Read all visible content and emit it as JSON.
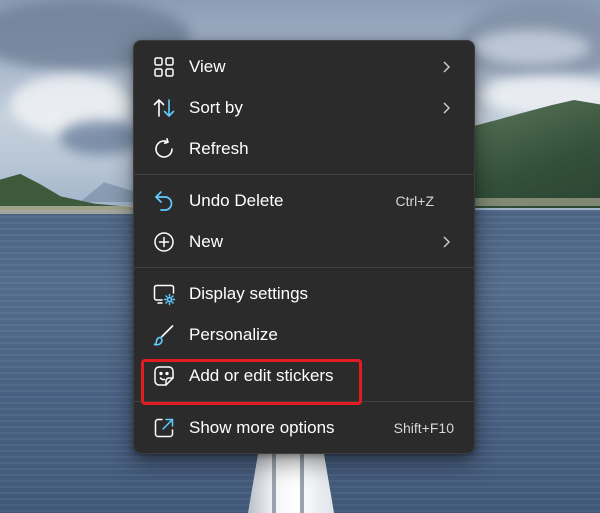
{
  "menu": {
    "items": [
      {
        "label": "View",
        "icon": "grid-view-icon",
        "has_submenu": true,
        "shortcut": ""
      },
      {
        "label": "Sort by",
        "icon": "sort-arrows-icon",
        "has_submenu": true,
        "shortcut": ""
      },
      {
        "label": "Refresh",
        "icon": "refresh-icon",
        "has_submenu": false,
        "shortcut": ""
      },
      {
        "label": "Undo Delete",
        "icon": "undo-icon",
        "has_submenu": false,
        "shortcut": "Ctrl+Z"
      },
      {
        "label": "New",
        "icon": "plus-circle-icon",
        "has_submenu": true,
        "shortcut": ""
      },
      {
        "label": "Display settings",
        "icon": "display-settings-icon",
        "has_submenu": false,
        "shortcut": ""
      },
      {
        "label": "Personalize",
        "icon": "brush-icon",
        "has_submenu": false,
        "shortcut": ""
      },
      {
        "label": "Add or edit stickers",
        "icon": "sticker-icon",
        "has_submenu": false,
        "shortcut": ""
      },
      {
        "label": "Show more options",
        "icon": "open-external-icon",
        "has_submenu": false,
        "shortcut": "Shift+F10"
      }
    ]
  },
  "colors": {
    "menu_background": "#2b2b2b",
    "menu_text": "#ffffff",
    "accent_icon": "#60cdff",
    "highlight_box": "#e21c21"
  }
}
